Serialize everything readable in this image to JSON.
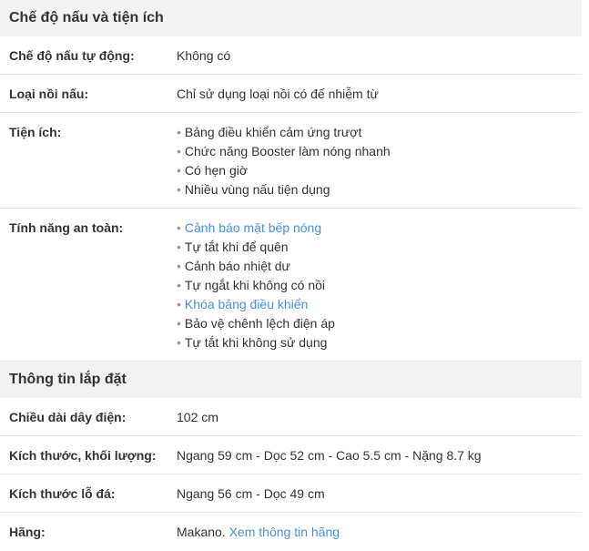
{
  "sections": [
    {
      "title": "Chế độ nấu và tiện ích",
      "rows": [
        {
          "label": "Chế độ nấu tự động:",
          "value": "Không có"
        },
        {
          "label": "Loại nồi nấu:",
          "value": "Chỉ sử dụng loại nồi có đế nhiễm từ"
        },
        {
          "label": "Tiện ích:",
          "items": [
            {
              "text": "Bảng điều khiển cảm ứng trượt"
            },
            {
              "text": "Chức năng Booster làm nóng nhanh"
            },
            {
              "text": "Có hẹn giờ"
            },
            {
              "text": "Nhiều vùng nấu tiện dụng"
            }
          ]
        },
        {
          "label": "Tính năng an toàn:",
          "items": [
            {
              "text": "Cảnh báo mặt bếp nóng",
              "link": true
            },
            {
              "text": "Tự tắt khi để quên"
            },
            {
              "text": "Cảnh báo nhiệt dư"
            },
            {
              "text": "Tự ngắt khi không có nồi"
            },
            {
              "text": "Khóa bảng điều khiển",
              "link": true
            },
            {
              "text": "Bảo vệ chênh lệch điện áp"
            },
            {
              "text": "Tự tắt khi không sử dụng"
            }
          ]
        }
      ]
    },
    {
      "title": "Thông tin lắp đặt",
      "rows": [
        {
          "label": "Chiều dài dây điện:",
          "value": "102 cm"
        },
        {
          "label": "Kích thước, khối lượng:",
          "value": "Ngang 59 cm - Dọc 52 cm - Cao 5.5 cm - Nặng 8.7 kg"
        },
        {
          "label": "Kích thước lỗ đá:",
          "value": "Ngang 56 cm - Dọc 49 cm"
        },
        {
          "label": "Hãng:",
          "value": "Makano.",
          "link_text": "Xem thông tin hãng"
        }
      ]
    }
  ],
  "bullet": "•",
  "colors": {
    "link": "#4a90d9",
    "header_bg": "#f2f2f2",
    "divider": "#e6e6e6"
  }
}
